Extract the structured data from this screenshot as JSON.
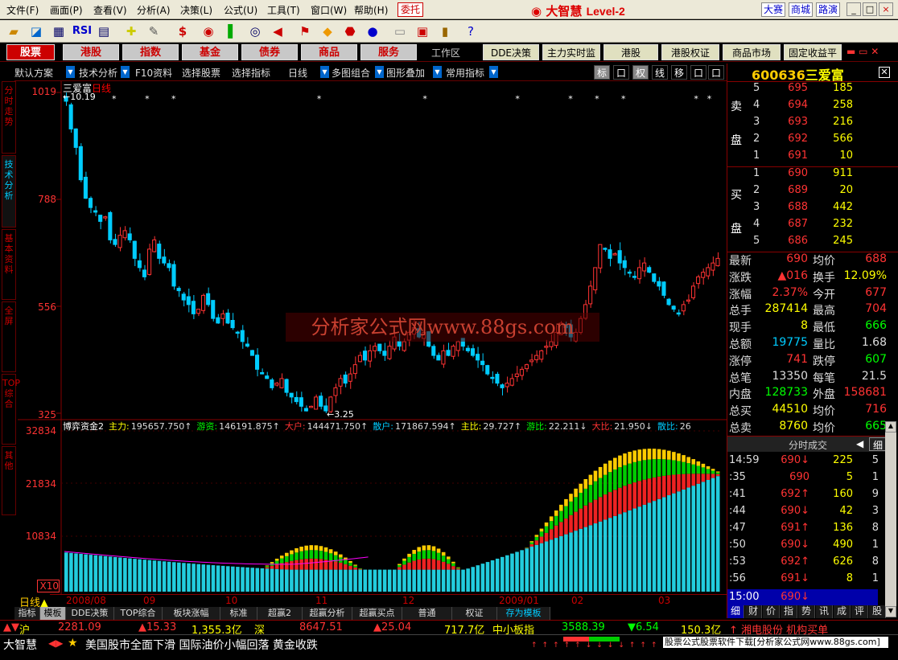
{
  "menu": {
    "items": [
      "文件(F)",
      "画面(P)",
      "查看(V)",
      "分析(A)",
      "决策(L)",
      "公式(U)",
      "工具(T)",
      "窗口(W)",
      "帮助(H)"
    ],
    "entrust": "委托",
    "brand": "大智慧",
    "brand_level": "Level-2",
    "links": [
      "大赛",
      "商城",
      "路演"
    ]
  },
  "toolbar_icons": [
    "open-folder-icon",
    "line-chart-icon",
    "quote-table-icon",
    "rsi-icon",
    "grid-icon",
    "crosshair-icon",
    "ruler-icon",
    "dollar-icon",
    "traffic-light-icon",
    "bar-signal-icon",
    "binoculars-icon",
    "megaphone-icon",
    "flag-icon",
    "diamond-icon",
    "stop-icon",
    "disc-icon",
    "notepad-icon",
    "calendar-icon",
    "books-icon",
    "help-icon"
  ],
  "rsi_label": "RSI",
  "nav": {
    "tabs": [
      "股票",
      "港股",
      "指数",
      "基金",
      "债券",
      "商品",
      "服务"
    ],
    "workspace": "工作区",
    "secondary": [
      "DDE决策",
      "主力实时监控",
      "港股",
      "港股权证",
      "商品市场",
      "固定收益平台"
    ]
  },
  "funcbar": {
    "items": [
      "默认方案",
      "技术分析",
      "F10资料",
      "选择股票",
      "选择指标",
      "日线",
      "多图组合",
      "图形叠加",
      "常用指标"
    ],
    "controls": [
      "标",
      "口",
      "权",
      "线",
      "移",
      "口",
      "口"
    ]
  },
  "left_tabs": [
    "分时走势",
    "技术分析",
    "基本资料",
    "全屏",
    "TOP综合",
    "其他"
  ],
  "chart": {
    "stock_name": "三爱富",
    "period": "日线",
    "high_label": "10.19",
    "low_label": "3.25",
    "price_axis": [
      "1019",
      "788",
      "556",
      "325"
    ],
    "vol_axis": [
      "32834",
      "21834",
      "10834",
      "X10"
    ],
    "x_labels": [
      "2008/08",
      "09",
      "10",
      "11",
      "12",
      "2009/01",
      "02",
      "03"
    ],
    "period_button": "日线",
    "watermark": "分析家公式网www.88gs.com",
    "indicator": {
      "name": "博弈资金2",
      "parts": [
        {
          "label": "主力:",
          "value": "195657.750↑",
          "color": "#ff0"
        },
        {
          "label": "游资:",
          "value": "146191.875↑",
          "color": "#0f0"
        },
        {
          "label": "大户:",
          "value": "144471.750↑",
          "color": "#f33"
        },
        {
          "label": "散户:",
          "value": "171867.594↑",
          "color": "#0cf"
        },
        {
          "label": "主比:",
          "value": "29.727↑",
          "color": "#ff0"
        },
        {
          "label": "游比:",
          "value": "22.211↓",
          "color": "#0f0"
        },
        {
          "label": "大比:",
          "value": "21.950↓",
          "color": "#f33"
        },
        {
          "label": "散比:",
          "value": "26",
          "color": "#0cf"
        }
      ]
    }
  },
  "chart_data": {
    "type": "candlestick",
    "title": "三爱富 日线",
    "ylim": [
      325,
      1019
    ],
    "x_labels": [
      "2008/08",
      "09",
      "10",
      "11",
      "12",
      "2009/01",
      "02",
      "03"
    ],
    "close": [
      1000,
      940,
      900,
      830,
      790,
      770,
      760,
      740,
      750,
      700,
      690,
      710,
      720,
      700,
      660,
      640,
      620,
      680,
      700,
      660,
      650,
      640,
      600,
      590,
      570,
      560,
      540,
      550,
      580,
      560,
      530,
      520,
      540,
      520,
      510,
      500,
      480,
      470,
      450,
      420,
      410,
      400,
      380,
      390,
      400,
      370,
      360,
      350,
      340,
      330,
      340,
      360,
      340,
      330,
      360,
      380,
      400,
      390,
      410,
      430,
      450,
      440,
      460,
      470,
      460,
      450,
      470,
      490,
      470,
      480,
      500,
      510,
      490,
      500,
      470,
      450,
      440,
      460,
      450,
      470,
      480,
      470,
      460,
      450,
      440,
      430,
      410,
      400,
      390,
      380,
      390,
      400,
      410,
      420,
      430,
      440,
      450,
      460,
      470,
      480,
      500,
      520,
      510,
      490,
      500,
      530,
      560,
      600,
      640,
      690,
      680,
      660,
      670,
      650,
      640,
      630,
      620,
      640,
      650,
      630,
      610,
      600,
      580,
      560,
      550,
      540,
      560,
      570,
      600,
      620,
      630,
      640,
      650,
      660
    ],
    "indicator": {
      "name": "博弈资金2",
      "ylim": [
        0,
        32834
      ],
      "series": [
        {
          "name": "主力",
          "color": "#fc0"
        },
        {
          "name": "游资",
          "color": "#0c0"
        },
        {
          "name": "大户",
          "color": "#e22"
        },
        {
          "name": "散户",
          "color": "#2cd"
        }
      ]
    }
  },
  "quote": {
    "code": "600636",
    "name": "三爱富",
    "sell_label": [
      "卖",
      "盘"
    ],
    "buy_label": [
      "买",
      "盘"
    ],
    "sell": [
      {
        "lvl": "5",
        "price": "695",
        "vol": "185"
      },
      {
        "lvl": "4",
        "price": "694",
        "vol": "258"
      },
      {
        "lvl": "3",
        "price": "693",
        "vol": "216"
      },
      {
        "lvl": "2",
        "price": "692",
        "vol": "566"
      },
      {
        "lvl": "1",
        "price": "691",
        "vol": "10"
      }
    ],
    "buy": [
      {
        "lvl": "1",
        "price": "690",
        "vol": "911"
      },
      {
        "lvl": "2",
        "price": "689",
        "vol": "20"
      },
      {
        "lvl": "3",
        "price": "688",
        "vol": "442"
      },
      {
        "lvl": "4",
        "price": "687",
        "vol": "232"
      },
      {
        "lvl": "5",
        "price": "686",
        "vol": "245"
      }
    ],
    "stats": [
      {
        "k1": "最新",
        "v1": "690",
        "c1": "#f33",
        "k2": "均价",
        "v2": "688",
        "c2": "#f33"
      },
      {
        "k1": "涨跌",
        "v1": "▲016",
        "c1": "#f33",
        "k2": "换手",
        "v2": "12.09%",
        "c2": "#ff0"
      },
      {
        "k1": "涨幅",
        "v1": "2.37%",
        "c1": "#f33",
        "k2": "今开",
        "v2": "677",
        "c2": "#f33"
      },
      {
        "k1": "总手",
        "v1": "287414",
        "c1": "#ff0",
        "k2": "最高",
        "v2": "704",
        "c2": "#f33"
      },
      {
        "k1": "现手",
        "v1": "8",
        "c1": "#ff0",
        "k2": "最低",
        "v2": "666",
        "c2": "#0f0"
      },
      {
        "k1": "总额",
        "v1": "19775",
        "c1": "#0cf",
        "k2": "量比",
        "v2": "1.68",
        "c2": "#ddd"
      },
      {
        "k1": "涨停",
        "v1": "741",
        "c1": "#f33",
        "k2": "跌停",
        "v2": "607",
        "c2": "#0f0"
      },
      {
        "k1": "总笔",
        "v1": "13350",
        "c1": "#ddd",
        "k2": "每笔",
        "v2": "21.5",
        "c2": "#ddd"
      },
      {
        "k1": "内盘",
        "v1": "128733",
        "c1": "#0f0",
        "k2": "外盘",
        "v2": "158681",
        "c2": "#f33"
      },
      {
        "k1": "总买",
        "v1": "44510",
        "c1": "#ff0",
        "k2": "均价",
        "v2": "716",
        "c2": "#f33"
      },
      {
        "k1": "总卖",
        "v1": "8760",
        "c1": "#ff0",
        "k2": "均价",
        "v2": "665",
        "c2": "#0f0"
      }
    ],
    "tick_title": "分时成交",
    "tick_detail": "细",
    "ticks": [
      {
        "t": "14:59",
        "p": "690↓",
        "v": "225",
        "n": "5"
      },
      {
        "t": ":35",
        "p": "690",
        "v": "5",
        "n": "1"
      },
      {
        "t": ":41",
        "p": "692↑",
        "v": "160",
        "n": "9"
      },
      {
        "t": ":44",
        "p": "690↓",
        "v": "42",
        "n": "3"
      },
      {
        "t": ":47",
        "p": "691↑",
        "v": "136",
        "n": "8"
      },
      {
        "t": ":50",
        "p": "690↓",
        "v": "490",
        "n": "1"
      },
      {
        "t": ":53",
        "p": "692↑",
        "v": "626",
        "n": "8"
      },
      {
        "t": ":56",
        "p": "691↓",
        "v": "8",
        "n": "1"
      }
    ],
    "last_tick": {
      "t": "15:00",
      "p": "690↓"
    },
    "tabs": [
      "细",
      "财",
      "价",
      "指",
      "势",
      "讯",
      "成",
      "评",
      "股"
    ]
  },
  "bottom_tabs": [
    "指标",
    "模板",
    "DDE决策",
    "TOP综合",
    "板块涨幅",
    "标准",
    "超赢2",
    "超赢分析",
    "超赢买点",
    "普通",
    "权证",
    "存为模板"
  ],
  "index_bar": {
    "sh_label": "沪",
    "sh_value": "2281.09",
    "sh_change": "▲15.33",
    "sh_amount": "1,355.3亿",
    "sz_label": "深",
    "sz_value": "8647.51",
    "sz_change": "▲25.04",
    "sz_amount": "717.7亿",
    "sme_label": "中小板指",
    "sme_value": "3588.39",
    "sme_change": "▼6.54",
    "sme_amount": "150.3亿",
    "ticker": "↑ 湘电股份 机构买单"
  },
  "news": {
    "brand": "大智慧",
    "headline": "美国股市全面下滑 国际油价小幅回落 黄金收跌",
    "ad": "股票公式股票软件下载[分析家公式网www.88gs.com]"
  }
}
